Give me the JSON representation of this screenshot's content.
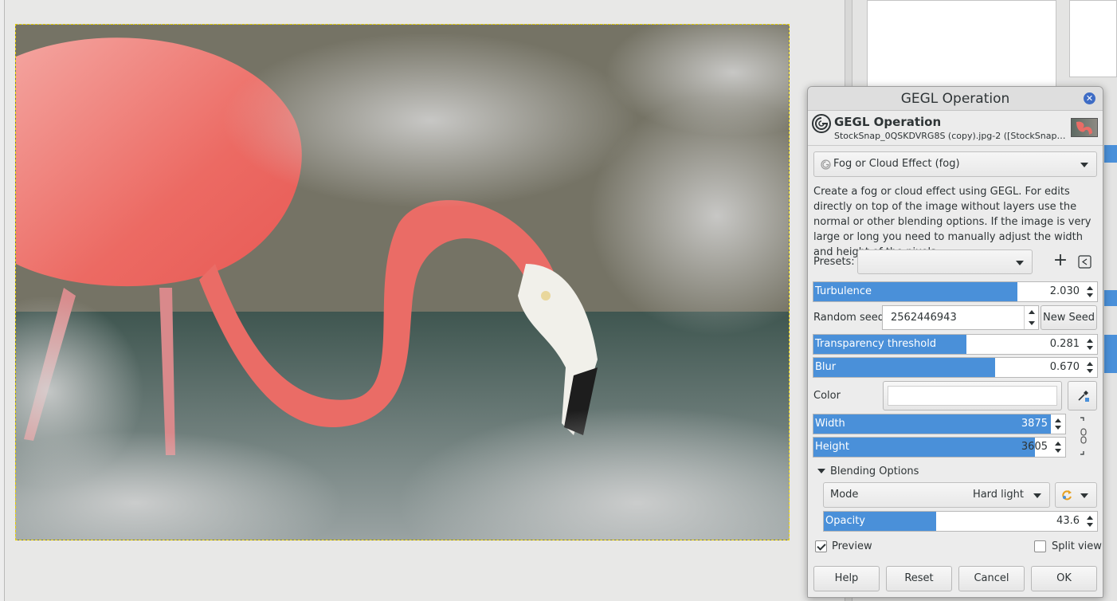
{
  "dialog": {
    "window_title": "GEGL Operation",
    "header_title": "GEGL Operation",
    "header_subtitle": "StockSnap_0QSKDVRG8S (copy).jpg-2 ([StockSnap_0Q...",
    "operation": "Fog or Cloud Effect (fog)",
    "description": "Create a fog or cloud effect using GEGL. For edits directly on top of the image without layers use the normal or other blending options. If the image is very large or long you need to manually adjust the width and height of the pixels.",
    "presets_label": "Presets:",
    "presets_value": "",
    "turbulence": {
      "label": "Turbulence",
      "value": "2.030",
      "fill": 0.72
    },
    "random_seed": {
      "label": "Random seed",
      "value": "2562446943",
      "new_seed_label": "New Seed"
    },
    "transparency": {
      "label": "Transparency threshold",
      "value": "0.281",
      "fill": 0.54
    },
    "blur": {
      "label": "Blur",
      "value": "0.670",
      "fill": 0.64
    },
    "color": {
      "label": "Color",
      "value": "#ffffff"
    },
    "width": {
      "label": "Width",
      "value": "3875",
      "fill": 0.98
    },
    "height": {
      "label": "Height",
      "value": "3605",
      "fill": 0.88
    },
    "blending": {
      "section_label": "Blending Options",
      "mode_label": "Mode",
      "mode_value": "Hard light",
      "opacity": {
        "label": "Opacity",
        "value": "43.6",
        "fill": 0.41
      }
    },
    "preview_label": "Preview",
    "preview_checked": true,
    "split_view_label": "Split view",
    "split_view_checked": false,
    "buttons": {
      "help": "Help",
      "reset": "Reset",
      "cancel": "Cancel",
      "ok": "OK"
    }
  },
  "colors": {
    "accent": "#4a90d9",
    "close": "#3e6cc5"
  },
  "icons": [
    "close-icon",
    "gegl-logo-icon",
    "add-preset-icon",
    "manage-presets-icon",
    "color-picker-icon",
    "chain-link-icon",
    "reset-blend-icon",
    "chevron-down-icon"
  ]
}
